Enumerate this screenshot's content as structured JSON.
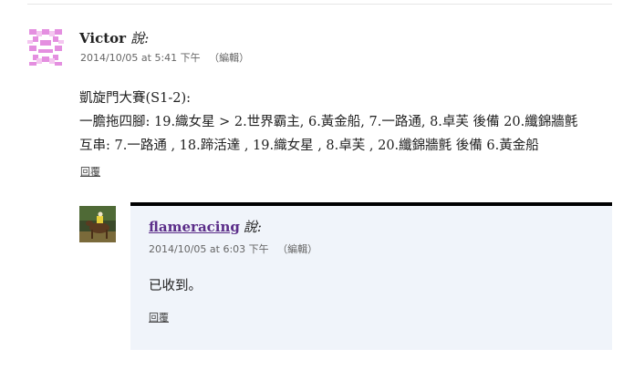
{
  "comment": {
    "author": "Victor",
    "says": "說:",
    "date": "2014/10/05 at 5:41 下午",
    "edit_label": "（編輯）",
    "lines": [
      "凱旋門大賽(S1-2):",
      "一膽拖四腳: 19.織女星 > 2.世界霸主, 6.黃金船, 7.一路通, 8.卓芙 後備 20.纖錦牆氈",
      "互串: 7.一路通 , 18.蹄活達 , 19.織女星 , 8.卓芙 , 20.纖錦牆氈 後備 6.黃金船"
    ],
    "reply_label": "回覆"
  },
  "reply_comment": {
    "author": "flameracing",
    "says": "說:",
    "date": "2014/10/05 at 6:03 下午",
    "edit_label": "（編輯）",
    "text": "已收到。",
    "reply_label": "回覆"
  }
}
